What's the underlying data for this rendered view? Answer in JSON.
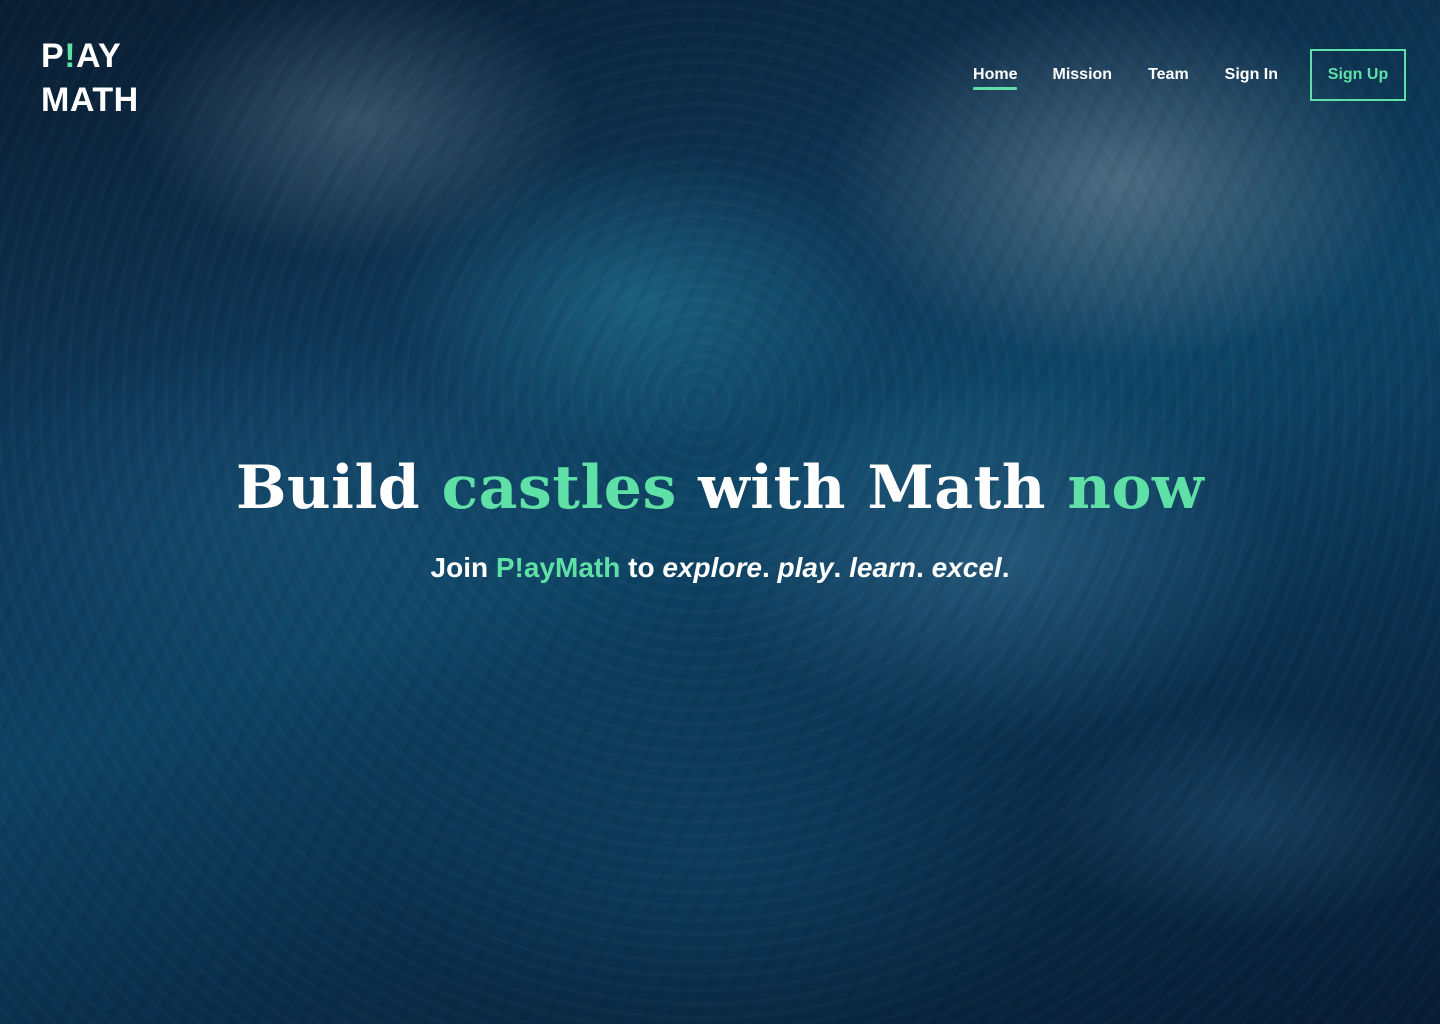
{
  "logo": {
    "line1_start": "P",
    "line1_accent": "!",
    "line1_end": "AY",
    "line2": "MATH"
  },
  "nav": {
    "home": "Home",
    "mission": "Mission",
    "team": "Team",
    "sign_in": "Sign In",
    "sign_up": "Sign Up"
  },
  "hero": {
    "title_part1": "Build ",
    "title_accent1": "castles",
    "title_part2": " with Math ",
    "title_accent2": "now",
    "subtitle_prefix": "Join ",
    "subtitle_brand": "P!ayMath",
    "subtitle_mid": " to ",
    "word1": "explore",
    "word2": "play",
    "word3": "learn",
    "word4": "excel",
    "separator": "."
  },
  "colors": {
    "accent": "#5fe0a6",
    "text": "#ffffff",
    "background": "#0f3a5c"
  }
}
